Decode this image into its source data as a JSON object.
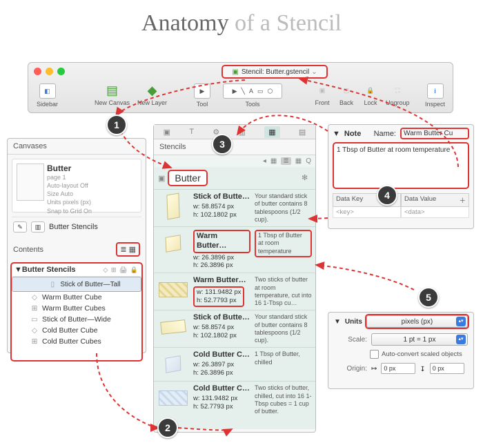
{
  "title_word1": "Anatomy",
  "title_word2": "of a Stencil",
  "window": {
    "document_title": "Stencil: Butter.gstencil"
  },
  "toolbar": {
    "sidebar": "Sidebar",
    "new_canvas": "New Canvas",
    "new_layer": "New Layer",
    "tool": "Tool",
    "tools": "Tools",
    "front": "Front",
    "back": "Back",
    "lock": "Lock",
    "ungroup": "Ungroup",
    "inspect": "Inspect"
  },
  "canvases": {
    "header": "Canvases",
    "card": {
      "name": "Butter",
      "page": "page 1",
      "auto_layout": "Auto-layout Off",
      "size": "Size Auto",
      "units": "Units pixels (px)",
      "snap": "Snap to Grid On"
    },
    "sublayer": "Butter Stencils",
    "contents_label": "Contents",
    "tree_title": "Butter Stencils",
    "items": [
      "Stick of Butter—Tall",
      "Warm Butter Cube",
      "Warm Butter Cubes",
      "Stick of Butter—Wide",
      "Cold Butter Cube",
      "Cold Butter Cubes"
    ]
  },
  "stencils": {
    "panel_label": "Stencils",
    "category": "Butter",
    "rows": [
      {
        "name": "Stick of Butte…",
        "w": "w: 58.8574 px",
        "h": "h: 102.1802 px",
        "desc": "Your standard stick of butter contains 8 tablespoons (1/2 cup)."
      },
      {
        "name": "Warm Butter…",
        "w": "w: 26.3896 px",
        "h": "h: 26.3896 px",
        "desc": "1 Tbsp of Butter at room temperature"
      },
      {
        "name": "Warm Butter…",
        "w": "w: 131.9482 px",
        "h": "h: 52.7793 px",
        "desc": "Two sticks of butter at room temperature, cut into 16 1-Tbsp cu…"
      },
      {
        "name": "Stick of Butte…",
        "w": "w: 58.8574 px",
        "h": "h: 102.1802 px",
        "desc": "Your standard stick of butter contains 8 tablespoons (1/2 cup)."
      },
      {
        "name": "Cold Butter C…",
        "w": "w: 26.3897 px",
        "h": "h: 26.3896 px",
        "desc": "1 Tbsp of Butter, chilled"
      },
      {
        "name": "Cold Butter C…",
        "w": "w: 131.9482 px",
        "h": "h: 52.7793 px",
        "desc": "Two sticks of butter, chilled, cut into 16 1-Tbsp cubes = 1 cup of butter."
      }
    ]
  },
  "note": {
    "section": "Note",
    "name_label": "Name:",
    "name_value": "Warm Butter Cu",
    "text": "1 Tbsp of Butter at room temperature",
    "datakey_hdr": "Data Key",
    "dataval_hdr": "Data Value",
    "key_ph": "<key>",
    "val_ph": "<data>"
  },
  "units": {
    "section": "Units",
    "units_value": "pixels (px)",
    "scale_label": "Scale:",
    "scale_value": "1 pt = 1 px",
    "autoconv": "Auto-convert scaled objects",
    "origin_label": "Origin:",
    "ox": "0 px",
    "oy": "0 px"
  },
  "badges": {
    "b1": "1",
    "b2": "2",
    "b3": "3",
    "b4": "4",
    "b5": "5"
  }
}
